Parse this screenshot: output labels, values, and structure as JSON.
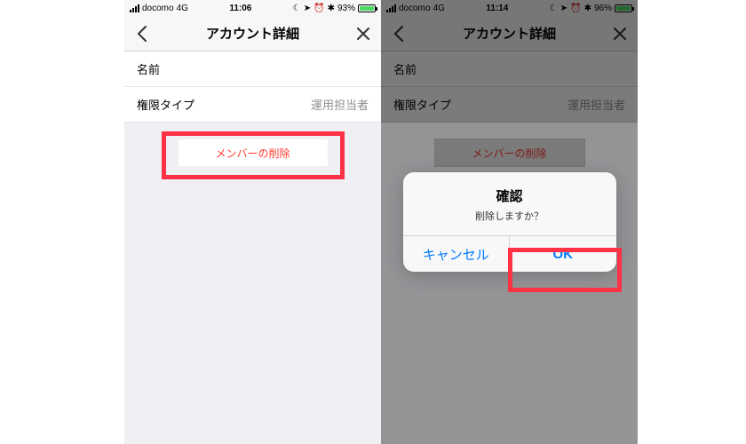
{
  "left": {
    "status": {
      "carrier": "docomo",
      "network": "4G",
      "time": "11:06",
      "battery_pct": "93%"
    },
    "nav": {
      "title": "アカウント詳細"
    },
    "rows": {
      "name": {
        "label": "名前",
        "value": "　　"
      },
      "role": {
        "label": "権限タイプ",
        "value": "運用担当者"
      }
    },
    "delete_label": "メンバーの削除"
  },
  "right": {
    "status": {
      "carrier": "docomo",
      "network": "4G",
      "time": "11:14",
      "battery_pct": "96%"
    },
    "nav": {
      "title": "アカウント詳細"
    },
    "rows": {
      "name": {
        "label": "名前",
        "value": "　　"
      },
      "role": {
        "label": "権限タイプ",
        "value": "運用担当者"
      }
    },
    "delete_label": "メンバーの削除",
    "alert": {
      "title": "確認",
      "message": "削除しますか？",
      "cancel": "キャンセル",
      "ok": "OK"
    }
  }
}
